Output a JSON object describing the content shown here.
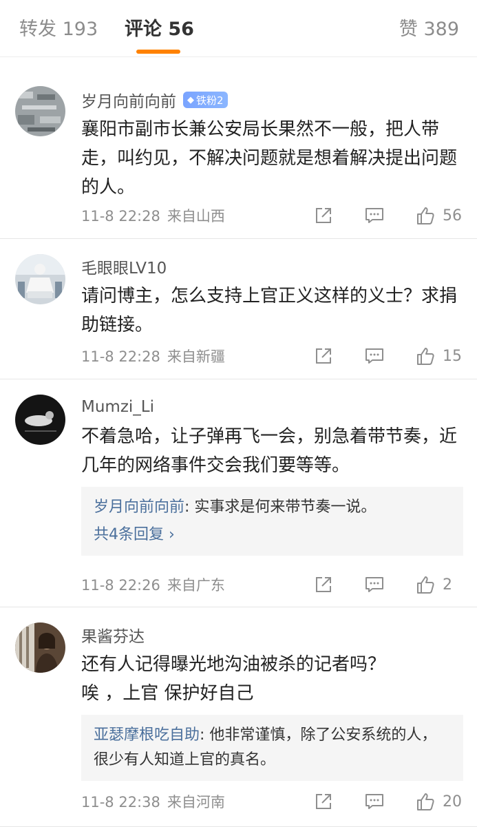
{
  "tabs": {
    "repost": "转发 193",
    "comments": "评论 56",
    "likes": "赞 389"
  },
  "accent_color": "#ff8200",
  "comments": [
    {
      "name": "岁月向前向前",
      "badge": "铁粉2",
      "text": "襄阳市副市长兼公安局长果然不一般，把人带走，叫约见，不解决问题就是想着解决提出问题的人。",
      "time": "11-8 22:28",
      "source": "来自山西",
      "likes": "56"
    },
    {
      "name": "毛眼眼LV10",
      "text": "请问博主，怎么支持上官正义这样的义士？求捐助链接。",
      "time": "11-8 22:28",
      "source": "来自新疆",
      "likes": "15"
    },
    {
      "name": "Mumzi_Li",
      "text": "不着急哈，让子弹再飞一会，别急着带节奏，近几年的网络事件交会我们要等等。",
      "reply": {
        "author": "岁月向前向前",
        "text": ": 实事求是何来带节奏一说。",
        "more": "共4条回复 ›"
      },
      "time": "11-8 22:26",
      "source": "来自广东",
      "likes": "2"
    },
    {
      "name": "果酱芬达",
      "text_line1": "还有人记得曝光地沟油被杀的记者吗？",
      "text_line2": "唉 ，上官 保护好自己",
      "reply": {
        "author": "亚瑟摩根吃自助",
        "text": ": 他非常谨慎，除了公安系统的人，很少有人知道上官的真名。"
      },
      "time": "11-8 22:38",
      "source": "来自河南",
      "likes": "20"
    }
  ],
  "icons": {
    "share": "share-icon",
    "reply": "comment-icon",
    "like": "thumbs-up-icon",
    "badge": "diamond-icon"
  }
}
